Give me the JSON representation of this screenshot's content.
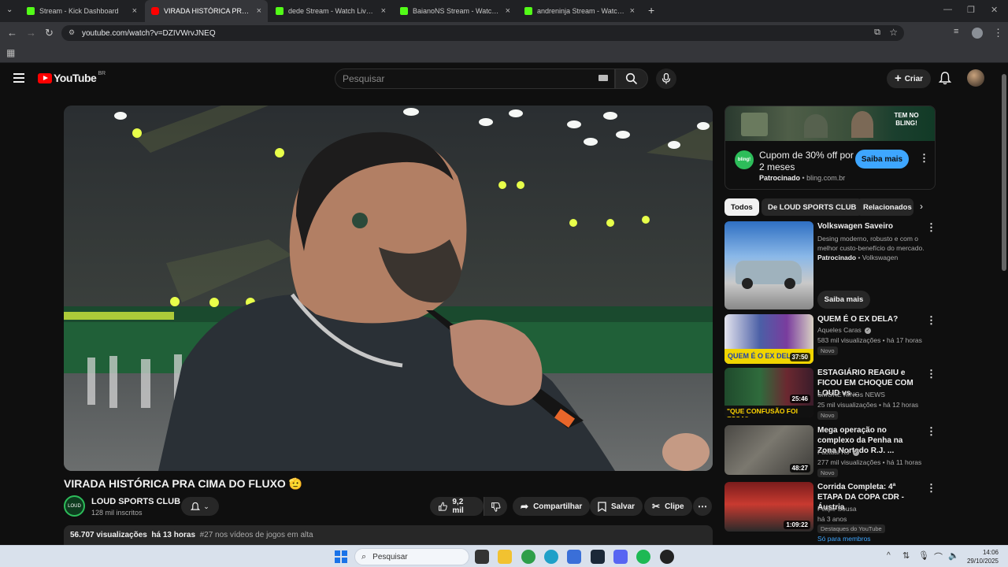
{
  "browser": {
    "tabs": [
      {
        "title": "Stream - Kick Dashboard",
        "favicon": "kick-icon",
        "active": false
      },
      {
        "title": "VIRADA HISTÓRICA PRA CIMA DO FLUXO",
        "favicon": "youtube-icon",
        "active": true
      },
      {
        "title": "dede Stream - Watch Live on Kick",
        "favicon": "kick-icon",
        "active": false
      },
      {
        "title": "BaianoNS Stream - Watch Live on Kick",
        "favicon": "kick-icon",
        "active": false
      },
      {
        "title": "andreninja Stream - Watch Live on Kick",
        "favicon": "kick-icon",
        "active": false
      }
    ],
    "url": "youtube.com/watch?v=DZIVWrvJNEQ"
  },
  "yt_header": {
    "logo": "YouTube",
    "country": "BR",
    "search_placeholder": "Pesquisar",
    "create_label": "Criar"
  },
  "video": {
    "title": "VIRADA HISTÓRICA PRA CIMA DO FLUXO 🫡",
    "channel": "LOUD SPORTS CLUB",
    "subscribers": "128 mil inscritos",
    "likes": "9,2 mil",
    "share_label": "Compartilhar",
    "save_label": "Salvar",
    "clip_label": "Clipe",
    "views": "56.707 visualizações",
    "age": "há 13 horas",
    "trending": "#27 nos vídeos de jogos em alta"
  },
  "ad": {
    "banner_text": "TEM NO BLING!",
    "logo_text": "bling!",
    "title": "Cupom de 30% off por 2 meses",
    "sponsored": "Patrocinado",
    "domain": "bling.com.br",
    "cta": "Saiba mais"
  },
  "chips": [
    "Todos",
    "De LOUD SPORTS CLUB",
    "Relacionados"
  ],
  "recommendations": [
    {
      "title": "Volkswagen Saveiro",
      "desc": "Desing moderno, robusto e com o melhor custo-benefício do mercado.",
      "sponsored": "Patrocinado",
      "advertiser": "Volkswagen",
      "cta": "Saiba mais"
    },
    {
      "title": "QUEM É O EX DELA?",
      "channel": "Aqueles Caras",
      "meta": "583 mil visualizações • há 17 horas",
      "badge": "Novo",
      "duration": "37:50"
    },
    {
      "title": "ESTAGIÁRIO REAGIU e FICOU EM CHOQUE COM LOUD vs ...",
      "channel": "SMOKE KINGs NEWS",
      "meta": "25 mil visualizações • há 12 horas",
      "badge": "Novo",
      "duration": "25:46"
    },
    {
      "title": "Mega operação no complexo da Penha  na Zona Nortedo R.J. ...",
      "channel": "Factual RJ",
      "meta": "277 mil visualizações • há 11 horas",
      "badge": "Novo",
      "duration": "48:27"
    },
    {
      "title": "Corrida Completa: 4ª ETAPA DA COPA CDR - Áustria",
      "channel": "Felipe Sousa",
      "meta": "há 3 anos",
      "badge": "Destaques do YouTube",
      "badge2": "Só para membros",
      "duration": "1:09:22"
    }
  ],
  "taskbar": {
    "search_placeholder": "Pesquisar",
    "time": "14:06",
    "date": "29/10/2025"
  }
}
